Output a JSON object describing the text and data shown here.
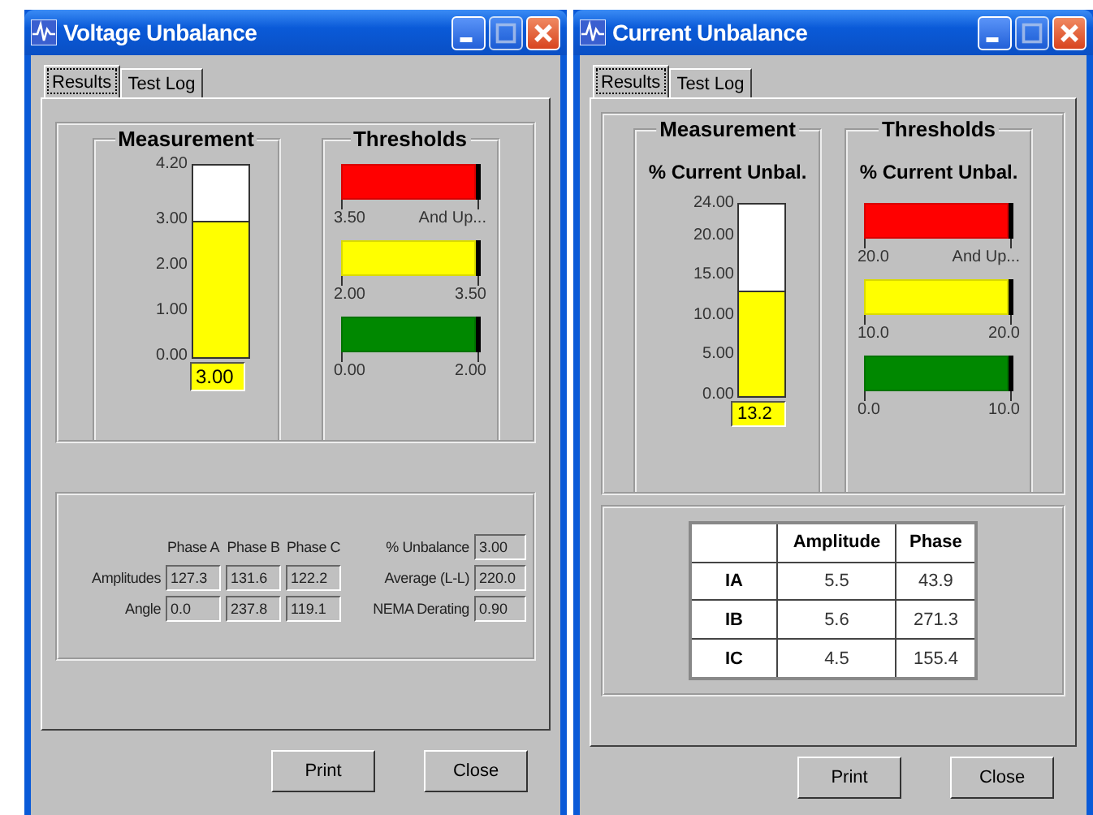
{
  "windows": [
    {
      "title": "Voltage Unbalance",
      "tabs": [
        {
          "label": "Results",
          "selected": true
        },
        {
          "label": "Test Log",
          "selected": false
        }
      ],
      "measurement": {
        "label": "Measurement",
        "ticks": [
          "4.20",
          "3.00",
          "2.00",
          "1.00",
          "0.00"
        ],
        "level": 0.714,
        "reading": "3.00"
      },
      "thresholds": {
        "label": "Thresholds",
        "bars": [
          {
            "color": "#ff0000",
            "low": "3.50",
            "high": "And Up..."
          },
          {
            "color": "#ffff00",
            "low": "2.00",
            "high": "3.50"
          },
          {
            "color": "#008800",
            "low": "0.00",
            "high": "2.00"
          }
        ]
      },
      "details": {
        "kind": "fields",
        "columns": [
          "Phase A",
          "Phase B",
          "Phase C"
        ],
        "rows": [
          {
            "label": "Amplitudes",
            "values": [
              "127.3",
              "131.6",
              "122.2"
            ]
          },
          {
            "label": "Angle",
            "values": [
              "0.0",
              "237.8",
              "119.1"
            ]
          }
        ],
        "stats": [
          {
            "label": "% Unbalance",
            "value": "3.00"
          },
          {
            "label": "Average (L-L)",
            "value": "220.0"
          },
          {
            "label": "NEMA Derating",
            "value": "0.90"
          }
        ]
      },
      "buttons": [
        "Print",
        "Close"
      ]
    },
    {
      "title": "Current Unbalance",
      "tabs": [
        {
          "label": "Results",
          "selected": true
        },
        {
          "label": "Test Log",
          "selected": false
        }
      ],
      "measurement": {
        "label": "Measurement",
        "subtitle": "% Current Unbal.",
        "ticks": [
          "24.00",
          "20.00",
          "15.00",
          "10.00",
          "5.00",
          "0.00"
        ],
        "level": 0.55,
        "reading": "13.2"
      },
      "thresholds": {
        "label": "Thresholds",
        "subtitle": "% Current Unbal.",
        "bars": [
          {
            "color": "#ff0000",
            "low": "20.0",
            "high": "And Up..."
          },
          {
            "color": "#ffff00",
            "low": "10.0",
            "high": "20.0"
          },
          {
            "color": "#008800",
            "low": "0.0",
            "high": "10.0"
          }
        ]
      },
      "details": {
        "kind": "table",
        "columns": [
          "Amplitude",
          "Phase"
        ],
        "rows": [
          {
            "label": "IA",
            "values": [
              "5.5",
              "43.9"
            ]
          },
          {
            "label": "IB",
            "values": [
              "5.6",
              "271.3"
            ]
          },
          {
            "label": "IC",
            "values": [
              "4.5",
              "155.4"
            ]
          }
        ]
      },
      "buttons": [
        "Print",
        "Close"
      ]
    }
  ]
}
